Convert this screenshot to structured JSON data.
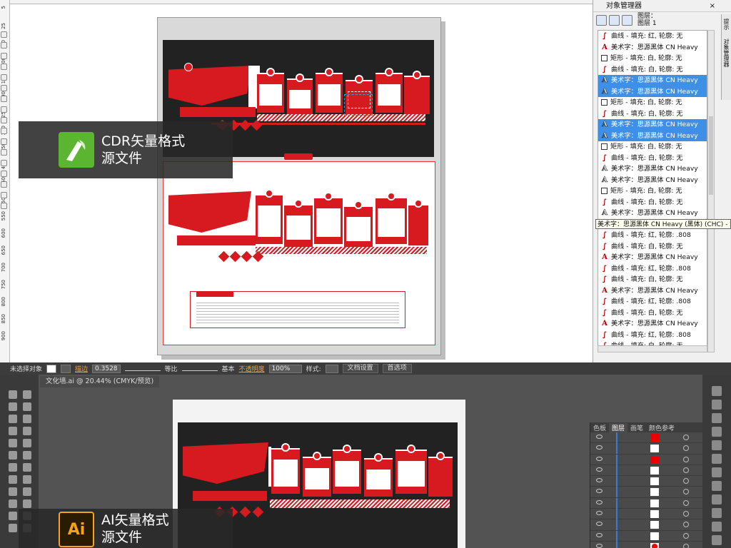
{
  "cdr": {
    "docker_title": "对象管理器",
    "layer_label": "图层：",
    "layer_name": "图层 1",
    "side_tabs": [
      "提示",
      "对象管理器"
    ],
    "tooltip": "美术字：思源黑体 CN Heavy (黑体) (CHC) - 填充: 白, 轮廓: 无",
    "objects": [
      {
        "type": "curve",
        "label": "曲线 - 填充: 红, 轮廓: 无",
        "selected": false
      },
      {
        "type": "art",
        "label": "美术字：思源黑体 CN Heavy",
        "selected": false
      },
      {
        "type": "rect",
        "label": "矩形 - 填充: 白, 轮廓: 无",
        "selected": false
      },
      {
        "type": "curve",
        "label": "曲线 - 填充: 白, 轮廓: 无",
        "selected": false
      },
      {
        "type": "art-out",
        "label": "美术字：思源黑体 CN Heavy",
        "selected": true
      },
      {
        "type": "art-out",
        "label": "美术字：思源黑体 CN Heavy",
        "selected": true
      },
      {
        "type": "rect",
        "label": "矩形 - 填充: 白, 轮廓: 无",
        "selected": false
      },
      {
        "type": "curve",
        "label": "曲线 - 填充: 白, 轮廓: 无",
        "selected": false
      },
      {
        "type": "art-out",
        "label": "美术字：思源黑体 CN Heavy",
        "selected": true
      },
      {
        "type": "art-out",
        "label": "美术字：思源黑体 CN Heavy",
        "selected": true
      },
      {
        "type": "rect",
        "label": "矩形 - 填充: 白, 轮廓: 无",
        "selected": false
      },
      {
        "type": "curve",
        "label": "曲线 - 填充: 白, 轮廓: 无",
        "selected": false
      },
      {
        "type": "art-out",
        "label": "美术字：思源黑体 CN Heavy",
        "selected": false
      },
      {
        "type": "art-out",
        "label": "美术字：思源黑体 CN Heavy",
        "selected": false
      },
      {
        "type": "rect",
        "label": "矩形 - 填充: 白, 轮廓: 无",
        "selected": false
      },
      {
        "type": "curve",
        "label": "曲线 - 填充: 白, 轮廓: 无",
        "selected": false
      },
      {
        "type": "art-out",
        "label": "美术字：思源黑体 CN Heavy",
        "selected": false
      },
      {
        "type": "art",
        "label": "美术字：思源黑体 CN Heavy (黑体) (CHC)",
        "selected": false
      },
      {
        "type": "curve",
        "label": "曲线 - 填充: 红, 轮廓: .808",
        "selected": false
      },
      {
        "type": "curve",
        "label": "曲线 - 填充: 白, 轮廓: 无",
        "selected": false
      },
      {
        "type": "art",
        "label": "美术字：思源黑体 CN Heavy",
        "selected": false
      },
      {
        "type": "curve",
        "label": "曲线 - 填充: 红, 轮廓: .808",
        "selected": false
      },
      {
        "type": "curve",
        "label": "曲线 - 填充: 白, 轮廓: 无",
        "selected": false
      },
      {
        "type": "art",
        "label": "美术字：思源黑体 CN Heavy",
        "selected": false
      },
      {
        "type": "curve",
        "label": "曲线 - 填充: 红, 轮廓: .808",
        "selected": false
      },
      {
        "type": "curve",
        "label": "曲线 - 填充: 白, 轮廓: 无",
        "selected": false
      },
      {
        "type": "art",
        "label": "美术字：思源黑体 CN Heavy",
        "selected": false
      },
      {
        "type": "curve",
        "label": "曲线 - 填充: 红, 轮廓: .808",
        "selected": false
      },
      {
        "type": "curve",
        "label": "曲线 - 填充: 白, 轮廓: 无",
        "selected": false
      }
    ],
    "badge_text_line1": "CDR矢量格式",
    "badge_text_line2": "源文件",
    "art_bottom_label": "",
    "ruler_left": [
      "5",
      "25",
      "50",
      "100",
      "150",
      "200",
      "250",
      "300",
      "350",
      "400",
      "450",
      "500",
      "550",
      "600",
      "650",
      "700",
      "750",
      "800",
      "850",
      "900"
    ]
  },
  "ai": {
    "control_bar": {
      "selection": "未选择对象",
      "stroke_label": "描边",
      "stroke_value": "0.3528",
      "uniform": "等比",
      "basic": "基本",
      "opacity_label": "不透明度",
      "opacity_value": "100%",
      "style_label": "样式:",
      "doc_setup": "文档设置",
      "prefs": "首选项"
    },
    "doc_tab": "文化墙.ai @ 20.44% (CMYK/预览)",
    "panel_tabs": [
      "色板",
      "图层",
      "画笔",
      "颜色参考"
    ],
    "active_panel_tab": "图层",
    "layer_rows": [
      "red",
      "plain",
      "red",
      "plain",
      "plain",
      "plain",
      "plain",
      "plain",
      "plain",
      "plain",
      "dot",
      "plain"
    ],
    "badge_text_line1": "AI矢量格式",
    "badge_text_line2": "源文件",
    "badge_logo": "Ai"
  },
  "colors": {
    "accent_red": "#d71920",
    "selection_blue": "#3d8fe8",
    "cdr_green": "#5cb531",
    "ai_orange": "#f7a21b"
  }
}
